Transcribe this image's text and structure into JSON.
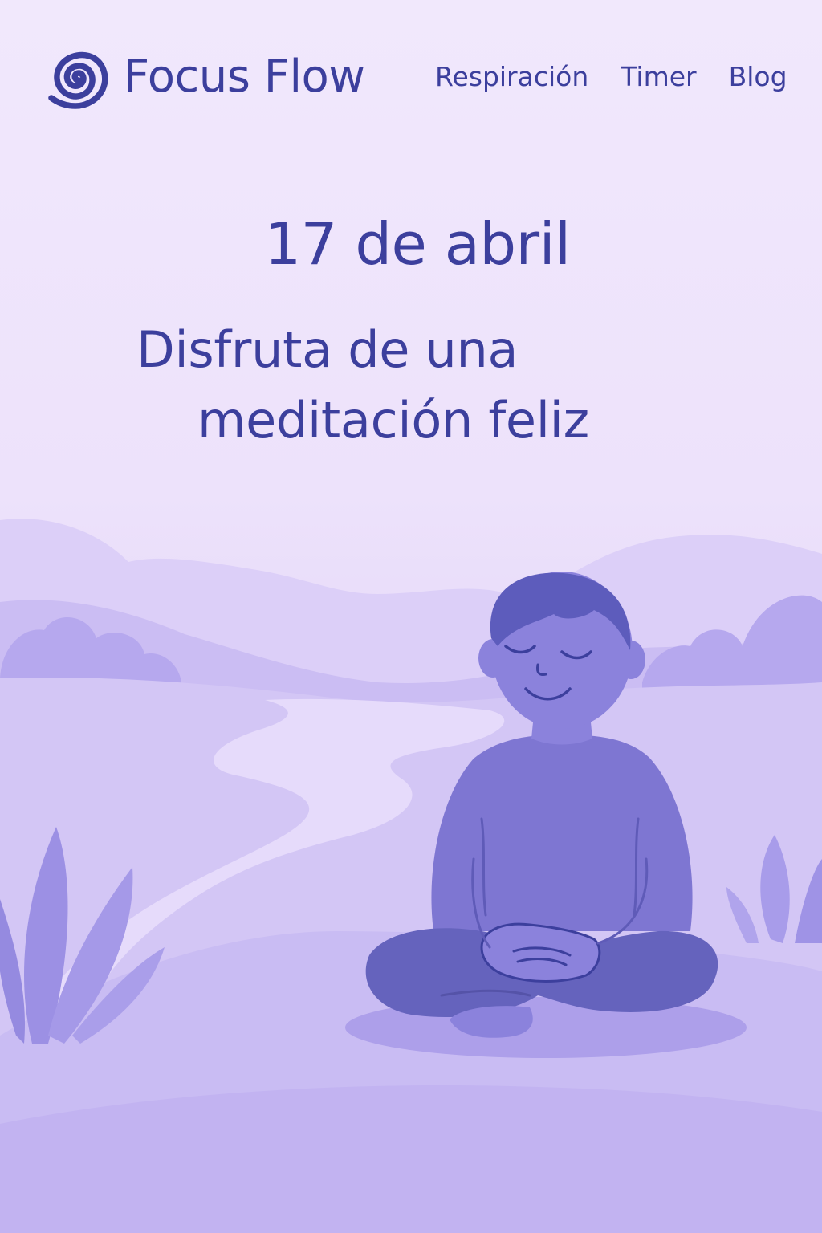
{
  "brand": {
    "name": "Focus Flow",
    "logo_icon": "spiral-icon"
  },
  "nav": {
    "items": [
      {
        "label": "Respiración"
      },
      {
        "label": "Timer"
      },
      {
        "label": "Blog"
      }
    ]
  },
  "hero": {
    "date": "17 de abril",
    "headline_line1": "Disfruta de una",
    "headline_line2": "meditación feliz"
  },
  "illustration": {
    "subject": "meditating-person-icon",
    "colors": {
      "accent": "#3c3f9d",
      "skin": "#8b82dc",
      "hair": "#5d5cbc",
      "body": "#7e76d2",
      "legs": "#6563bd",
      "hills_light": "#d8ccf6",
      "hills_mid": "#c4b6f1",
      "river": "#e8dcfb"
    }
  }
}
